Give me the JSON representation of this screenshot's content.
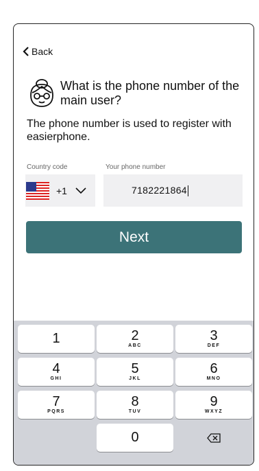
{
  "nav": {
    "back_label": "Back"
  },
  "header": {
    "title": "What is the phone number of the main user?",
    "subtitle": "The phone number is used to register with easierphone."
  },
  "form": {
    "country_code_label": "Country code",
    "country_code_value": "+1",
    "country_flag": "us-flag-icon",
    "phone_label": "Your phone number",
    "phone_value": "7182221864"
  },
  "actions": {
    "next_label": "Next"
  },
  "keypad": {
    "keys": [
      {
        "num": "1",
        "letters": ""
      },
      {
        "num": "2",
        "letters": "ABC"
      },
      {
        "num": "3",
        "letters": "DEF"
      },
      {
        "num": "4",
        "letters": "GHI"
      },
      {
        "num": "5",
        "letters": "JKL"
      },
      {
        "num": "6",
        "letters": "MNO"
      },
      {
        "num": "7",
        "letters": "PQRS"
      },
      {
        "num": "8",
        "letters": "TUV"
      },
      {
        "num": "9",
        "letters": "WXYZ"
      },
      {
        "num": "0",
        "letters": ""
      }
    ],
    "delete_icon": "backspace-icon"
  },
  "colors": {
    "accent": "#3c7378",
    "field_bg": "#f0f0f2",
    "keypad_bg": "#d1d3d9"
  }
}
